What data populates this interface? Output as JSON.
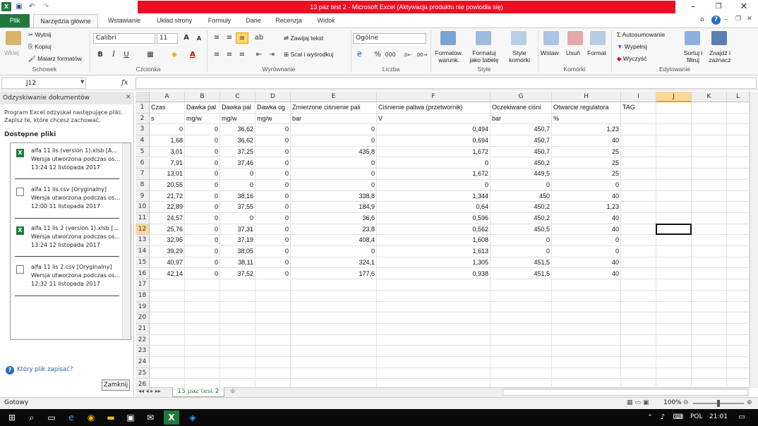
{
  "window": {
    "title": "13 paz test 2  -  Microsoft Excel (Aktywacja produktu nie powiodła się)",
    "qat_icons": [
      "excel-icon",
      "save-icon",
      "undo-icon",
      "redo-icon"
    ],
    "controls": [
      "minimize-icon",
      "restore-icon",
      "close-icon"
    ]
  },
  "tabs": [
    "Plik",
    "Narzędzia główne",
    "Wstawianie",
    "Układ strony",
    "Formuły",
    "Dane",
    "Recenzja",
    "Widok"
  ],
  "ribbon": {
    "clipboard": {
      "paste": "Wklej",
      "cut": "Wytnij",
      "copy": "Kopiuj",
      "painter": "Malarz formatów",
      "group": "Schowek"
    },
    "font": {
      "name": "Calibri",
      "size": "11",
      "group": "Czcionka",
      "bold": "B",
      "italic": "I",
      "underline": "U"
    },
    "alignment": {
      "wrap": "Zawijaj tekst",
      "merge": "Scal i wyśrodkuj",
      "group": "Wyrównanie"
    },
    "number": {
      "format": "Ogólne",
      "percent": "%",
      "thousands": "000",
      "group": "Liczba"
    },
    "styles": {
      "cond": "Formatow.\nwarunk.",
      "table": "Formatuj\njako tabelę",
      "cell": "Style\nkomórki",
      "group": "Style"
    },
    "cells": {
      "insert": "Wstaw",
      "delete": "Usuń",
      "format": "Format",
      "group": "Komórki"
    },
    "editing": {
      "autosum": "Autosumowanie",
      "fill": "Wypełnij",
      "clear": "Wyczyść",
      "sort": "Sortuj i\nfiltruj",
      "find": "Znajdź i\nzaznacz",
      "group": "Edytowanie"
    }
  },
  "formula_bar": {
    "name_box": "J12",
    "fx": "fx",
    "content": ""
  },
  "recovery": {
    "header": "Odzyskiwanie dokumentów",
    "desc": "Program Excel odzyskał następujące pliki. Zapisz te, które chcesz zachować.",
    "available": "Dostępne pliki",
    "files": [
      {
        "icon": "excel-file-icon",
        "name": "alfa 11 lis (version 1).xlsb  [A...",
        "desc": "Wersja utworzona podczas os...",
        "time": "13:24 12 listopada 2017"
      },
      {
        "icon": "csv-file-icon",
        "name": "alfa 11 lis.csv  [Oryginalny]",
        "desc": "Wersja utworzona podczas os...",
        "time": "12:00 11 listopada 2017"
      },
      {
        "icon": "excel-file-icon",
        "name": "alfa 11 lis 2 (version 1).xlsb  [...",
        "desc": "Wersja utworzona podczas os...",
        "time": "13:24 12 listopada 2017"
      },
      {
        "icon": "csv-file-icon",
        "name": "alfa 11 lis 2.csv  [Oryginalny]",
        "desc": "Wersja utworzona podczas os...",
        "time": "12:32 11 listopada 2017"
      }
    ],
    "which": "Który plik zapisać?",
    "close": "Zamknij"
  },
  "sheet": {
    "columns": [
      "A",
      "B",
      "C",
      "D",
      "E",
      "F",
      "G",
      "H",
      "I",
      "J",
      "K",
      "L"
    ],
    "selected_col": "J",
    "selected_row": 12,
    "header_row": [
      "Czas",
      "Dawka pal",
      "Dawka pal",
      "Dawka og",
      "Zmierzone ciśnienie pali",
      "Ciśnienie paliwa (przetwornik)",
      "Oczekiwane ciśni",
      "Otwarcie regulatora",
      "TAG"
    ],
    "unit_row": [
      "s",
      "mg/w",
      "mg/w",
      "mg/w",
      "bar",
      "V",
      "bar",
      "%",
      ""
    ],
    "data": [
      [
        "0",
        "0",
        "36,62",
        "0",
        "0",
        "0,494",
        "450,7",
        "1,23"
      ],
      [
        "1,68",
        "0",
        "36,62",
        "0",
        "0",
        "0,694",
        "450,7",
        "40"
      ],
      [
        "3,01",
        "0",
        "37,25",
        "0",
        "435,8",
        "1,672",
        "450,7",
        "25"
      ],
      [
        "7,91",
        "0",
        "37,46",
        "0",
        "0",
        "0",
        "450,2",
        "25"
      ],
      [
        "13,01",
        "0",
        "0",
        "0",
        "0",
        "1,672",
        "449,5",
        "25"
      ],
      [
        "20,55",
        "0",
        "0",
        "0",
        "0",
        "0",
        "0",
        "0"
      ],
      [
        "21,72",
        "0",
        "38,16",
        "0",
        "338,8",
        "1,344",
        "450",
        "40"
      ],
      [
        "22,89",
        "0",
        "37,55",
        "0",
        "184,9",
        "0,64",
        "450,2",
        "1,23"
      ],
      [
        "24,57",
        "0",
        "0",
        "0",
        "36,6",
        "0,596",
        "450,2",
        "40"
      ],
      [
        "25,76",
        "0",
        "37,31",
        "0",
        "23,8",
        "0,562",
        "450,5",
        "40"
      ],
      [
        "32,95",
        "0",
        "37,19",
        "0",
        "408,4",
        "1,608",
        "0",
        "0"
      ],
      [
        "39,29",
        "0",
        "38,05",
        "0",
        "0",
        "1,613",
        "0",
        "0"
      ],
      [
        "40,97",
        "0",
        "38,11",
        "0",
        "324,1",
        "1,305",
        "451,5",
        "40"
      ],
      [
        "42,14",
        "0",
        "37,52",
        "0",
        "177,6",
        "0,938",
        "451,5",
        "40"
      ]
    ],
    "row_numbers": [
      "1",
      "2",
      "3",
      "4",
      "5",
      "6",
      "7",
      "8",
      "9",
      "10",
      "11",
      "12",
      "13",
      "14",
      "15",
      "16",
      "17",
      "18",
      "19",
      "20",
      "21",
      "22",
      "23",
      "24",
      "25",
      "26"
    ],
    "tab_name": "13 paz test 2"
  },
  "status": {
    "text": "Gotowy",
    "zoom": "100%"
  },
  "taskbar": {
    "lang": "POL",
    "time": "21:01"
  }
}
